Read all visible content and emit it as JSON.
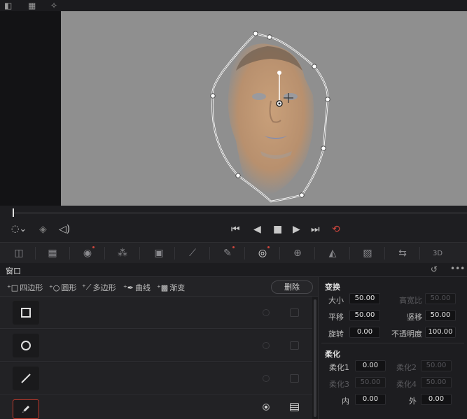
{
  "toolbar_top": {
    "icons": [
      "single-viewer-icon",
      "grid-icon",
      "magic-wand-icon"
    ]
  },
  "palette": {
    "tools": [
      {
        "icon": "camera-raw-icon",
        "glyph": "◫"
      },
      {
        "icon": "color-match-icon",
        "glyph": "▦"
      },
      {
        "icon": "primaries-wheels-icon",
        "glyph": "◉",
        "dot": true
      },
      {
        "icon": "hdr-wheels-icon",
        "glyph": "⁂"
      },
      {
        "icon": "rgb-mixer-icon",
        "glyph": "▣"
      },
      {
        "icon": "curves-icon",
        "glyph": "⟋"
      },
      {
        "icon": "qualifier-icon",
        "glyph": "✎",
        "dot": true
      },
      {
        "icon": "window-icon",
        "glyph": "◎",
        "active": true,
        "dot": true
      },
      {
        "icon": "tracker-icon",
        "glyph": "⊕"
      },
      {
        "icon": "blur-icon",
        "glyph": "◭"
      },
      {
        "icon": "key-icon",
        "glyph": "▨"
      },
      {
        "icon": "sizing-icon",
        "glyph": "⇆"
      },
      {
        "icon": "3d-icon",
        "glyph": "3D"
      }
    ]
  },
  "panel": {
    "title": "窗口"
  },
  "tools": {
    "quad": "四边形",
    "circle": "圆形",
    "polygon": "多边形",
    "curve": "曲线",
    "gradient": "渐变",
    "delete": "删除"
  },
  "rows": [
    {
      "shape": "square-icon",
      "active": false
    },
    {
      "shape": "circle-icon",
      "active": false
    },
    {
      "shape": "line-icon",
      "active": false
    },
    {
      "shape": "pen-icon",
      "active": true
    }
  ],
  "transform": {
    "title": "变换",
    "size_label": "大小",
    "size": "50.00",
    "aspect_label": "高宽比",
    "aspect": "50.00",
    "pan_label": "平移",
    "pan": "50.00",
    "tilt_label": "竖移",
    "tilt": "50.00",
    "rotate_label": "旋转",
    "rotate": "0.00",
    "opacity_label": "不透明度",
    "opacity": "100.00"
  },
  "softness": {
    "title": "柔化",
    "s1_label": "柔化1",
    "s1": "0.00",
    "s2_label": "柔化2",
    "s2": "50.00",
    "s3_label": "柔化3",
    "s3": "50.00",
    "s4_label": "柔化4",
    "s4": "50.00",
    "inside_label": "内",
    "inside": "0.00",
    "outside_label": "外",
    "outside": "0.00"
  },
  "colors": {
    "accent": "#d0463d",
    "viewer_bg": "#8f8f8f"
  }
}
